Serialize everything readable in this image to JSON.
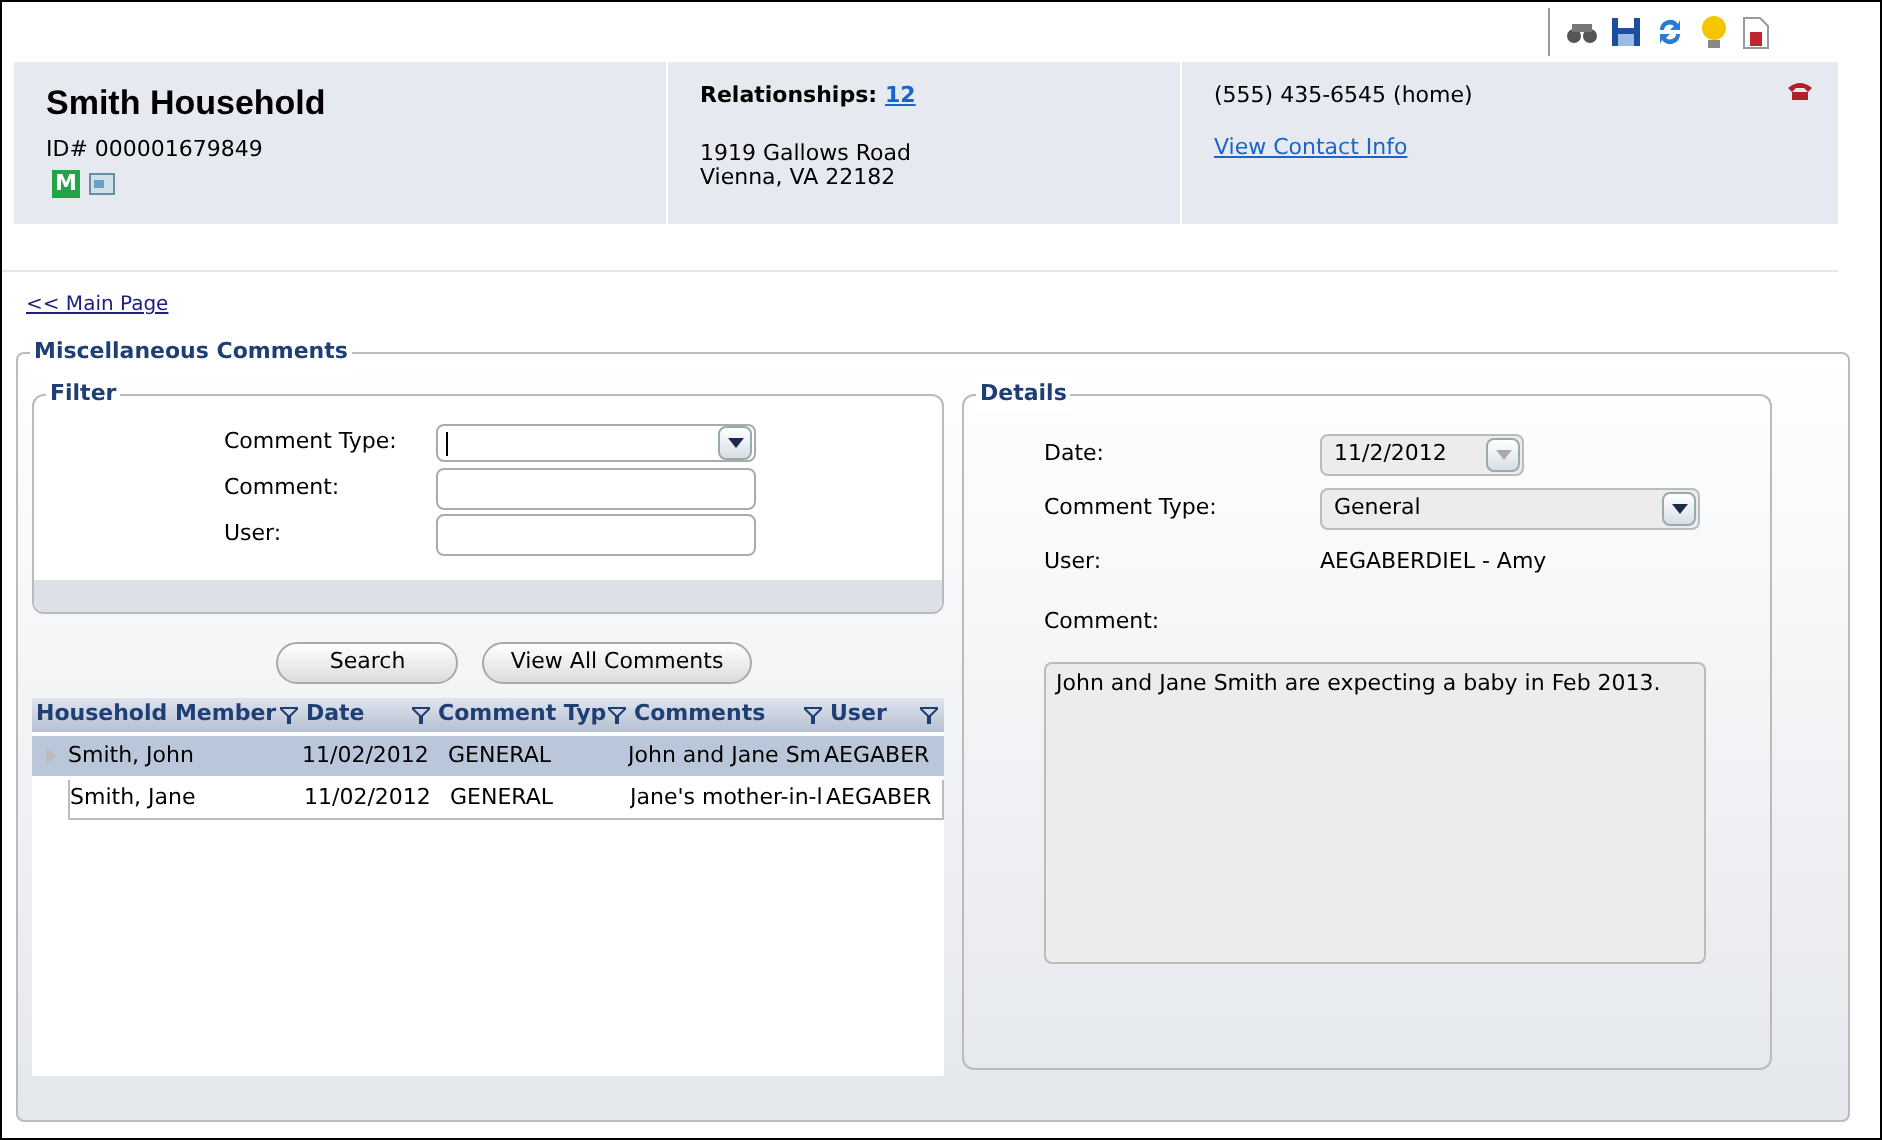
{
  "header": {
    "title": "Smith Household",
    "id_label": "ID# 000001679849",
    "badge": "M",
    "relationships_label": "Relationships:",
    "relationships_count": "12",
    "address": [
      "1919 Gallows Road",
      "Vienna, VA 22182"
    ],
    "phone": "(555) 435-6545 (home)",
    "contact_link": "View Contact Info"
  },
  "main_link": "<< Main Page",
  "section_title": "Miscellaneous Comments",
  "filter": {
    "title": "Filter",
    "fields": [
      {
        "kind": "dropdown",
        "label": "Comment Type:"
      },
      {
        "kind": "text",
        "label": "Comment:"
      },
      {
        "kind": "text",
        "label": "User:"
      }
    ]
  },
  "buttons": [
    "Search",
    "View All Comments"
  ],
  "table": {
    "columns": [
      "Household Member",
      "Date",
      "Comment Typ",
      "Comments",
      "User"
    ],
    "rows": [
      {
        "selected": true,
        "cells": [
          "Smith, John",
          "11/02/2012",
          "GENERAL",
          "John and Jane Sm",
          "AEGABER"
        ]
      },
      {
        "selected": false,
        "cells": [
          "Smith, Jane",
          "11/02/2012",
          "GENERAL",
          "Jane's mother-in-l",
          "AEGABER"
        ]
      }
    ]
  },
  "details": {
    "title": "Details",
    "date_label": "Date:",
    "date": "11/2/2012",
    "type_label": "Comment Type:",
    "type": "General",
    "user_label": "User:",
    "user": "AEGABERDIEL - Amy",
    "comment_label": "Comment:",
    "comment": "John and Jane Smith are expecting a baby in Feb 2013."
  }
}
